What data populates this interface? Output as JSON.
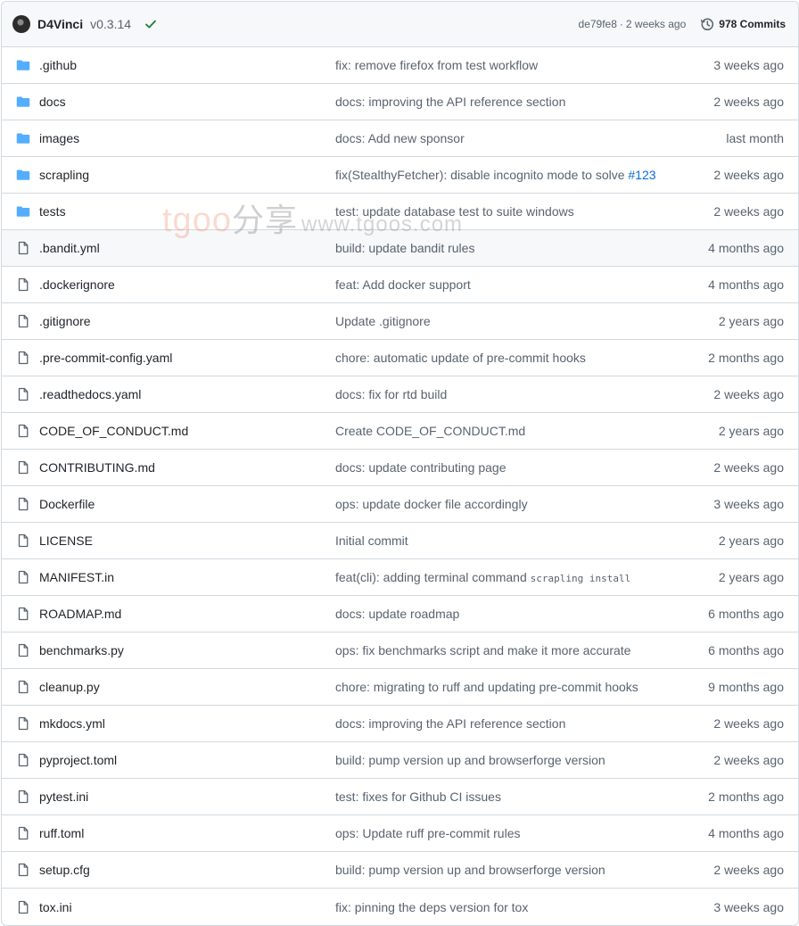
{
  "header": {
    "author": "D4Vinci",
    "version": "v0.3.14",
    "commit_hash": "de79fe8",
    "separator": "·",
    "commit_time": "2 weeks ago",
    "commits_label": "978 Commits"
  },
  "watermark": {
    "latin": "tgoo",
    "cn": "分享",
    "url": "www.tgoos.com"
  },
  "colors": {
    "folder": "#54aeff",
    "link": "#0969da",
    "check": "#1a7f37",
    "muted": "#59636e"
  },
  "files": [
    {
      "type": "folder",
      "name": ".github",
      "message": "fix: remove firefox from test workflow",
      "age": "3 weeks ago"
    },
    {
      "type": "folder",
      "name": "docs",
      "message": "docs: improving the API reference section",
      "age": "2 weeks ago"
    },
    {
      "type": "folder",
      "name": "images",
      "message": "docs: Add new sponsor",
      "age": "last month"
    },
    {
      "type": "folder",
      "name": "scrapling",
      "message": "fix(StealthyFetcher): disable incognito mode to solve ",
      "issue": "#123",
      "age": "2 weeks ago"
    },
    {
      "type": "folder",
      "name": "tests",
      "message": "test: update database test to suite windows",
      "age": "2 weeks ago"
    },
    {
      "type": "file",
      "name": ".bandit.yml",
      "message": "build: update bandit rules",
      "age": "4 months ago"
    },
    {
      "type": "file",
      "name": ".dockerignore",
      "message": "feat: Add docker support",
      "age": "4 months ago"
    },
    {
      "type": "file",
      "name": ".gitignore",
      "message": "Update .gitignore",
      "age": "2 years ago"
    },
    {
      "type": "file",
      "name": ".pre-commit-config.yaml",
      "message": "chore: automatic update of pre-commit hooks",
      "age": "2 months ago"
    },
    {
      "type": "file",
      "name": ".readthedocs.yaml",
      "message": "docs: fix for rtd build",
      "age": "2 weeks ago"
    },
    {
      "type": "file",
      "name": "CODE_OF_CONDUCT.md",
      "message": "Create CODE_OF_CONDUCT.md",
      "age": "2 years ago"
    },
    {
      "type": "file",
      "name": "CONTRIBUTING.md",
      "message": "docs: update contributing page",
      "age": "2 weeks ago"
    },
    {
      "type": "file",
      "name": "Dockerfile",
      "message": "ops: update docker file accordingly",
      "age": "3 weeks ago"
    },
    {
      "type": "file",
      "name": "LICENSE",
      "message": "Initial commit",
      "age": "2 years ago"
    },
    {
      "type": "file",
      "name": "MANIFEST.in",
      "message": "feat(cli): adding terminal command ",
      "code": "scrapling install",
      "age": "2 years ago"
    },
    {
      "type": "file",
      "name": "ROADMAP.md",
      "message": "docs: update roadmap",
      "age": "6 months ago"
    },
    {
      "type": "file",
      "name": "benchmarks.py",
      "message": "ops: fix benchmarks script and make it more accurate",
      "age": "6 months ago"
    },
    {
      "type": "file",
      "name": "cleanup.py",
      "message": "chore: migrating to ruff and updating pre-commit hooks",
      "age": "9 months ago"
    },
    {
      "type": "file",
      "name": "mkdocs.yml",
      "message": "docs: improving the API reference section",
      "age": "2 weeks ago"
    },
    {
      "type": "file",
      "name": "pyproject.toml",
      "message": "build: pump version up and browserforge version",
      "age": "2 weeks ago"
    },
    {
      "type": "file",
      "name": "pytest.ini",
      "message": "test: fixes for Github CI issues",
      "age": "2 months ago"
    },
    {
      "type": "file",
      "name": "ruff.toml",
      "message": "ops: Update ruff pre-commit rules",
      "age": "4 months ago"
    },
    {
      "type": "file",
      "name": "setup.cfg",
      "message": "build: pump version up and browserforge version",
      "age": "2 weeks ago"
    },
    {
      "type": "file",
      "name": "tox.ini",
      "message": "fix: pinning the deps version for tox",
      "age": "3 weeks ago"
    }
  ]
}
